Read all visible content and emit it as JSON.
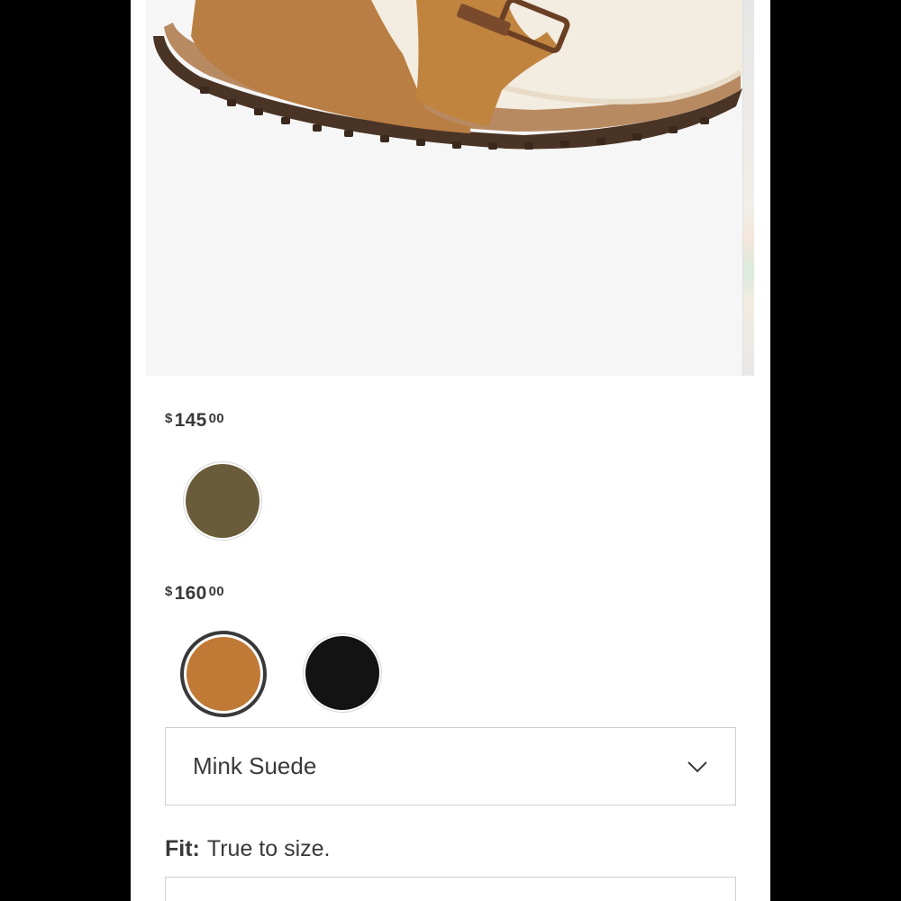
{
  "product": {
    "image_alt": "Shearling-lined suede buckle sandal",
    "price_groups": [
      {
        "currency": "$",
        "dollars": "145",
        "cents": "00",
        "swatches": [
          {
            "name": "Olive suede",
            "color": "#6a5c3a",
            "selected": false
          }
        ]
      },
      {
        "currency": "$",
        "dollars": "160",
        "cents": "00",
        "swatches": [
          {
            "name": "Mink suede",
            "color": "#c07a36",
            "selected": true
          },
          {
            "name": "Black suede",
            "color": "#141313",
            "selected": false
          }
        ]
      }
    ]
  },
  "color_select": {
    "value": "Mink Suede",
    "icon": "chevron-down-icon"
  },
  "fit": {
    "label": "Fit:",
    "value": "True to size."
  },
  "colors": {
    "text": "#393939",
    "border": "#cfcfcf",
    "selected_ring": "#393939",
    "image_bg": "#f6f6f6"
  }
}
